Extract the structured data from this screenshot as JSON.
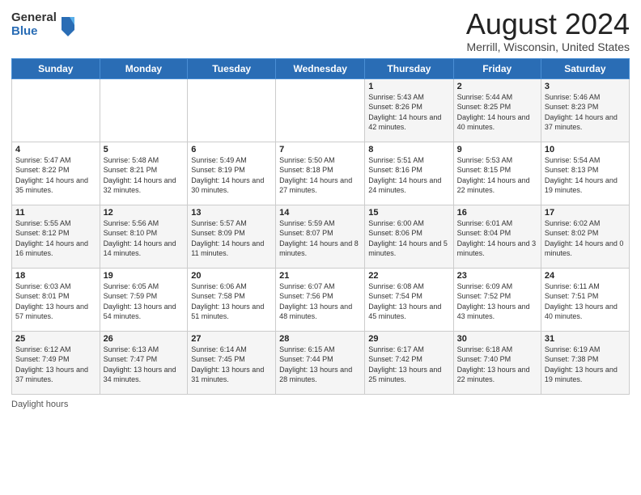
{
  "logo": {
    "general": "General",
    "blue": "Blue"
  },
  "title": "August 2024",
  "subtitle": "Merrill, Wisconsin, United States",
  "days_of_week": [
    "Sunday",
    "Monday",
    "Tuesday",
    "Wednesday",
    "Thursday",
    "Friday",
    "Saturday"
  ],
  "weeks": [
    [
      {
        "day": "",
        "info": ""
      },
      {
        "day": "",
        "info": ""
      },
      {
        "day": "",
        "info": ""
      },
      {
        "day": "",
        "info": ""
      },
      {
        "day": "1",
        "info": "Sunrise: 5:43 AM\nSunset: 8:26 PM\nDaylight: 14 hours and 42 minutes."
      },
      {
        "day": "2",
        "info": "Sunrise: 5:44 AM\nSunset: 8:25 PM\nDaylight: 14 hours and 40 minutes."
      },
      {
        "day": "3",
        "info": "Sunrise: 5:46 AM\nSunset: 8:23 PM\nDaylight: 14 hours and 37 minutes."
      }
    ],
    [
      {
        "day": "4",
        "info": "Sunrise: 5:47 AM\nSunset: 8:22 PM\nDaylight: 14 hours and 35 minutes."
      },
      {
        "day": "5",
        "info": "Sunrise: 5:48 AM\nSunset: 8:21 PM\nDaylight: 14 hours and 32 minutes."
      },
      {
        "day": "6",
        "info": "Sunrise: 5:49 AM\nSunset: 8:19 PM\nDaylight: 14 hours and 30 minutes."
      },
      {
        "day": "7",
        "info": "Sunrise: 5:50 AM\nSunset: 8:18 PM\nDaylight: 14 hours and 27 minutes."
      },
      {
        "day": "8",
        "info": "Sunrise: 5:51 AM\nSunset: 8:16 PM\nDaylight: 14 hours and 24 minutes."
      },
      {
        "day": "9",
        "info": "Sunrise: 5:53 AM\nSunset: 8:15 PM\nDaylight: 14 hours and 22 minutes."
      },
      {
        "day": "10",
        "info": "Sunrise: 5:54 AM\nSunset: 8:13 PM\nDaylight: 14 hours and 19 minutes."
      }
    ],
    [
      {
        "day": "11",
        "info": "Sunrise: 5:55 AM\nSunset: 8:12 PM\nDaylight: 14 hours and 16 minutes."
      },
      {
        "day": "12",
        "info": "Sunrise: 5:56 AM\nSunset: 8:10 PM\nDaylight: 14 hours and 14 minutes."
      },
      {
        "day": "13",
        "info": "Sunrise: 5:57 AM\nSunset: 8:09 PM\nDaylight: 14 hours and 11 minutes."
      },
      {
        "day": "14",
        "info": "Sunrise: 5:59 AM\nSunset: 8:07 PM\nDaylight: 14 hours and 8 minutes."
      },
      {
        "day": "15",
        "info": "Sunrise: 6:00 AM\nSunset: 8:06 PM\nDaylight: 14 hours and 5 minutes."
      },
      {
        "day": "16",
        "info": "Sunrise: 6:01 AM\nSunset: 8:04 PM\nDaylight: 14 hours and 3 minutes."
      },
      {
        "day": "17",
        "info": "Sunrise: 6:02 AM\nSunset: 8:02 PM\nDaylight: 14 hours and 0 minutes."
      }
    ],
    [
      {
        "day": "18",
        "info": "Sunrise: 6:03 AM\nSunset: 8:01 PM\nDaylight: 13 hours and 57 minutes."
      },
      {
        "day": "19",
        "info": "Sunrise: 6:05 AM\nSunset: 7:59 PM\nDaylight: 13 hours and 54 minutes."
      },
      {
        "day": "20",
        "info": "Sunrise: 6:06 AM\nSunset: 7:58 PM\nDaylight: 13 hours and 51 minutes."
      },
      {
        "day": "21",
        "info": "Sunrise: 6:07 AM\nSunset: 7:56 PM\nDaylight: 13 hours and 48 minutes."
      },
      {
        "day": "22",
        "info": "Sunrise: 6:08 AM\nSunset: 7:54 PM\nDaylight: 13 hours and 45 minutes."
      },
      {
        "day": "23",
        "info": "Sunrise: 6:09 AM\nSunset: 7:52 PM\nDaylight: 13 hours and 43 minutes."
      },
      {
        "day": "24",
        "info": "Sunrise: 6:11 AM\nSunset: 7:51 PM\nDaylight: 13 hours and 40 minutes."
      }
    ],
    [
      {
        "day": "25",
        "info": "Sunrise: 6:12 AM\nSunset: 7:49 PM\nDaylight: 13 hours and 37 minutes."
      },
      {
        "day": "26",
        "info": "Sunrise: 6:13 AM\nSunset: 7:47 PM\nDaylight: 13 hours and 34 minutes."
      },
      {
        "day": "27",
        "info": "Sunrise: 6:14 AM\nSunset: 7:45 PM\nDaylight: 13 hours and 31 minutes."
      },
      {
        "day": "28",
        "info": "Sunrise: 6:15 AM\nSunset: 7:44 PM\nDaylight: 13 hours and 28 minutes."
      },
      {
        "day": "29",
        "info": "Sunrise: 6:17 AM\nSunset: 7:42 PM\nDaylight: 13 hours and 25 minutes."
      },
      {
        "day": "30",
        "info": "Sunrise: 6:18 AM\nSunset: 7:40 PM\nDaylight: 13 hours and 22 minutes."
      },
      {
        "day": "31",
        "info": "Sunrise: 6:19 AM\nSunset: 7:38 PM\nDaylight: 13 hours and 19 minutes."
      }
    ]
  ],
  "footer": "Daylight hours"
}
